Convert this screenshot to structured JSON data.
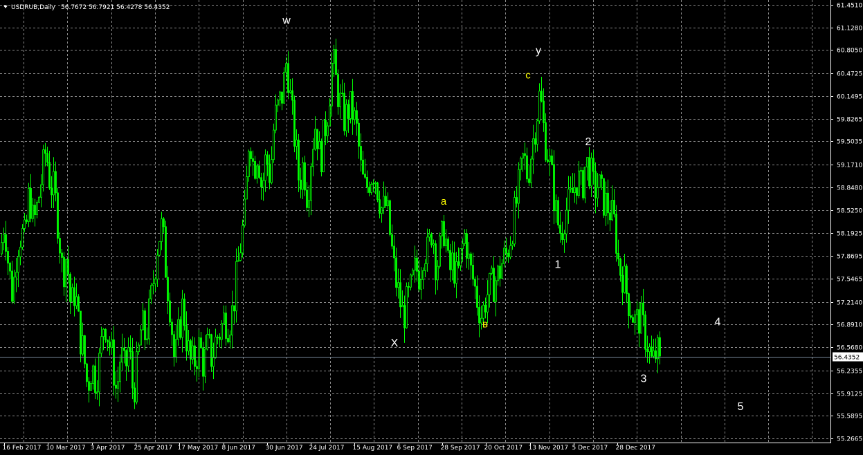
{
  "window": {
    "symbol_title": "USDRUB,Daily",
    "ohlc": "56.7672 56.7921 56.4278 56.4352",
    "menu_arrow_icon": "triangle-down-icon"
  },
  "colors": {
    "background": "#000000",
    "grid": "#ffffff",
    "candle_bull": "#00ff00",
    "candle_bear": "#00ff00",
    "bid_line": "#778899",
    "label_white": "#ffffff",
    "label_yellow": "#ffff00"
  },
  "chart_data": {
    "type": "candlestick",
    "symbol": "USDRUB",
    "timeframe": "Daily",
    "ylim": [
      55.2665,
      61.451
    ],
    "grid": true,
    "y_ticks": [
      "61.4510",
      "61.1280",
      "60.8050",
      "60.4725",
      "60.1495",
      "59.8265",
      "59.5035",
      "59.1710",
      "58.8480",
      "58.5250",
      "58.1925",
      "57.8695",
      "57.5465",
      "57.2140",
      "56.8910",
      "56.5680",
      "56.2355",
      "55.9125",
      "55.5895",
      "55.2665"
    ],
    "x_ticks": [
      "16 Feb 2017",
      "10 Mar 2017",
      "3 Apr 2017",
      "25 Apr 2017",
      "17 May 2017",
      "8 Jun 2017",
      "30 Jun 2017",
      "24 Jul 2017",
      "15 Aug 2017",
      "6 Sep 2017",
      "28 Sep 2017",
      "20 Oct 2017",
      "13 Nov 2017",
      "5 Dec 2017",
      "28 Dec 2017"
    ],
    "current_price": "56.4352",
    "close_path": [
      [
        0,
        57.9
      ],
      [
        6,
        58.4
      ],
      [
        12,
        57.7
      ],
      [
        18,
        57.3
      ],
      [
        24,
        58.0
      ],
      [
        30,
        58.2
      ],
      [
        36,
        58.1
      ],
      [
        42,
        58.8
      ],
      [
        48,
        58.3
      ],
      [
        54,
        58.6
      ],
      [
        60,
        59.0
      ],
      [
        66,
        59.4
      ],
      [
        72,
        58.9
      ],
      [
        78,
        58.8
      ],
      [
        84,
        58.3
      ],
      [
        90,
        57.6
      ],
      [
        96,
        57.9
      ],
      [
        102,
        57.1
      ],
      [
        108,
        57.4
      ],
      [
        114,
        56.8
      ],
      [
        120,
        56.5
      ],
      [
        126,
        56.0
      ],
      [
        132,
        56.3
      ],
      [
        138,
        56.1
      ],
      [
        144,
        56.4
      ],
      [
        150,
        57.0
      ],
      [
        156,
        56.7
      ],
      [
        162,
        56.4
      ],
      [
        168,
        55.9
      ],
      [
        174,
        56.5
      ],
      [
        180,
        56.2
      ],
      [
        186,
        56.6
      ],
      [
        192,
        55.9
      ],
      [
        198,
        56.3
      ],
      [
        204,
        56.9
      ],
      [
        210,
        56.7
      ],
      [
        216,
        57.1
      ],
      [
        222,
        57.6
      ],
      [
        228,
        58.1
      ],
      [
        234,
        58.3
      ],
      [
        240,
        57.6
      ],
      [
        246,
        57.1
      ],
      [
        252,
        56.3
      ],
      [
        258,
        56.8
      ],
      [
        264,
        57.2
      ],
      [
        270,
        56.6
      ],
      [
        276,
        56.3
      ],
      [
        282,
        56.4
      ],
      [
        288,
        56.6
      ],
      [
        294,
        56.3
      ],
      [
        300,
        56.6
      ],
      [
        306,
        56.4
      ],
      [
        312,
        56.7
      ],
      [
        318,
        56.8
      ],
      [
        324,
        57.0
      ],
      [
        330,
        56.9
      ],
      [
        336,
        57.1
      ],
      [
        342,
        57.6
      ],
      [
        348,
        58.1
      ],
      [
        354,
        58.5
      ],
      [
        360,
        59.7
      ],
      [
        366,
        59.1
      ],
      [
        372,
        59.4
      ],
      [
        378,
        58.8
      ],
      [
        384,
        59.3
      ],
      [
        390,
        59.0
      ],
      [
        396,
        59.8
      ],
      [
        402,
        60.0
      ],
      [
        408,
        60.2
      ],
      [
        414,
        60.7
      ],
      [
        420,
        60.0
      ],
      [
        426,
        59.5
      ],
      [
        432,
        58.9
      ],
      [
        438,
        59.2
      ],
      [
        444,
        58.7
      ],
      [
        450,
        59.4
      ],
      [
        456,
        59.8
      ],
      [
        462,
        59.2
      ],
      [
        468,
        59.6
      ],
      [
        474,
        60.0
      ],
      [
        480,
        60.7
      ],
      [
        486,
        60.3
      ],
      [
        492,
        60.0
      ],
      [
        498,
        59.8
      ],
      [
        504,
        60.0
      ],
      [
        510,
        59.9
      ],
      [
        516,
        59.6
      ],
      [
        522,
        59.0
      ],
      [
        528,
        58.8
      ],
      [
        534,
        59.0
      ],
      [
        540,
        59.1
      ],
      [
        546,
        58.8
      ],
      [
        552,
        58.5
      ],
      [
        558,
        58.6
      ],
      [
        564,
        58.1
      ],
      [
        570,
        57.6
      ],
      [
        576,
        57.3
      ],
      [
        582,
        57.0
      ],
      [
        588,
        57.2
      ],
      [
        594,
        57.4
      ],
      [
        600,
        57.7
      ],
      [
        606,
        57.6
      ],
      [
        612,
        58.0
      ],
      [
        618,
        57.9
      ],
      [
        624,
        58.3
      ],
      [
        630,
        57.7
      ],
      [
        636,
        58.0
      ],
      [
        642,
        58.3
      ],
      [
        648,
        57.6
      ],
      [
        654,
        57.8
      ],
      [
        660,
        57.5
      ],
      [
        666,
        57.9
      ],
      [
        672,
        58.2
      ],
      [
        678,
        57.7
      ],
      [
        684,
        57.5
      ],
      [
        690,
        57.2
      ],
      [
        696,
        57.0
      ],
      [
        702,
        57.3
      ],
      [
        708,
        57.4
      ],
      [
        714,
        57.5
      ],
      [
        720,
        57.6
      ],
      [
        726,
        57.8
      ],
      [
        732,
        57.9
      ],
      [
        738,
        58.2
      ],
      [
        744,
        58.5
      ],
      [
        750,
        58.9
      ],
      [
        756,
        59.3
      ],
      [
        762,
        59.0
      ],
      [
        768,
        59.4
      ],
      [
        774,
        59.8
      ],
      [
        780,
        60.2
      ],
      [
        786,
        59.6
      ],
      [
        792,
        59.3
      ],
      [
        798,
        58.9
      ],
      [
        804,
        58.4
      ],
      [
        810,
        58.2
      ],
      [
        816,
        58.5
      ],
      [
        822,
        58.6
      ],
      [
        828,
        58.8
      ],
      [
        834,
        59.0
      ],
      [
        840,
        58.8
      ],
      [
        846,
        59.2
      ],
      [
        852,
        59.1
      ],
      [
        858,
        58.8
      ],
      [
        864,
        58.9
      ],
      [
        870,
        58.7
      ],
      [
        876,
        58.6
      ],
      [
        882,
        58.5
      ],
      [
        888,
        58.3
      ],
      [
        894,
        57.7
      ],
      [
        900,
        57.6
      ],
      [
        906,
        57.3
      ],
      [
        912,
        57.1
      ],
      [
        918,
        56.9
      ],
      [
        924,
        57.0
      ],
      [
        930,
        56.8
      ],
      [
        936,
        56.6
      ],
      [
        942,
        56.3
      ],
      [
        948,
        56.5
      ],
      [
        954,
        56.44
      ]
    ],
    "annotations": [
      {
        "text": "w",
        "x": 414,
        "y": 61.18,
        "color": "white"
      },
      {
        "text": "y",
        "x": 778,
        "y": 60.75,
        "color": "white"
      },
      {
        "text": "c",
        "x": 763,
        "y": 60.4,
        "color": "yellow"
      },
      {
        "text": "2",
        "x": 850,
        "y": 59.45,
        "color": "white"
      },
      {
        "text": "a",
        "x": 641,
        "y": 58.6,
        "color": "yellow"
      },
      {
        "text": "1",
        "x": 806,
        "y": 57.7,
        "color": "white"
      },
      {
        "text": "в",
        "x": 701,
        "y": 56.85,
        "color": "yellow"
      },
      {
        "text": "4",
        "x": 1037,
        "y": 56.88,
        "color": "white"
      },
      {
        "text": "X",
        "x": 570,
        "y": 56.58,
        "color": "white"
      },
      {
        "text": "3",
        "x": 930,
        "y": 56.07,
        "color": "white"
      },
      {
        "text": "5",
        "x": 1070,
        "y": 55.67,
        "color": "white"
      }
    ]
  }
}
